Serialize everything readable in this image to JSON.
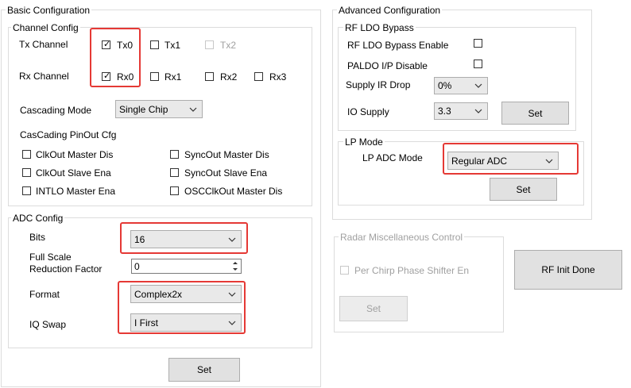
{
  "basic": {
    "title": "Basic Configuration",
    "channel": {
      "title": "Channel Config",
      "tx_label": "Tx Channel",
      "rx_label": "Rx Channel",
      "tx": [
        {
          "label": "Tx0",
          "checked": true,
          "enabled": true
        },
        {
          "label": "Tx1",
          "checked": false,
          "enabled": true
        },
        {
          "label": "Tx2",
          "checked": false,
          "enabled": false
        }
      ],
      "rx": [
        {
          "label": "Rx0",
          "checked": true
        },
        {
          "label": "Rx1",
          "checked": false
        },
        {
          "label": "Rx2",
          "checked": false
        },
        {
          "label": "Rx3",
          "checked": false
        }
      ],
      "cascading_label": "Cascading Mode",
      "cascading_value": "Single Chip",
      "pinout_label": "CasCading PinOut Cfg",
      "pinout": [
        {
          "label": "ClkOut Master Dis",
          "checked": false
        },
        {
          "label": "SyncOut Master Dis",
          "checked": false
        },
        {
          "label": "ClkOut Slave Ena",
          "checked": false
        },
        {
          "label": "SyncOut Slave Ena",
          "checked": false
        },
        {
          "label": "INTLO Master Ena",
          "checked": false
        },
        {
          "label": "OSCClkOut Master Dis",
          "checked": false
        }
      ]
    },
    "adc": {
      "title": "ADC Config",
      "bits_label": "Bits",
      "bits_value": "16",
      "fsrf_label_1": "Full Scale",
      "fsrf_label_2": "Reduction Factor",
      "fsrf_value": "0",
      "format_label": "Format",
      "format_value": "Complex2x",
      "iq_label": "IQ Swap",
      "iq_value": "I First"
    },
    "set_label": "Set"
  },
  "advanced": {
    "title": "Advanced Configuration",
    "rfldo": {
      "title": "RF LDO Bypass",
      "bypass_label": "RF LDO Bypass Enable",
      "bypass_checked": false,
      "paldo_label": "PALDO I/P Disable",
      "paldo_checked": false,
      "ir_label": "Supply IR Drop",
      "ir_value": "0%",
      "io_label": "IO Supply",
      "io_value": "3.3",
      "set_label": "Set"
    },
    "lp": {
      "title": "LP Mode",
      "adc_mode_label": "LP ADC Mode",
      "adc_mode_value": "Regular ADC",
      "set_label": "Set"
    }
  },
  "radar": {
    "title": "Radar Miscellaneous Control",
    "shifter_label": "Per Chirp Phase Shifter En",
    "shifter_checked": false,
    "set_label": "Set"
  },
  "rf_init_label": "RF Init Done"
}
